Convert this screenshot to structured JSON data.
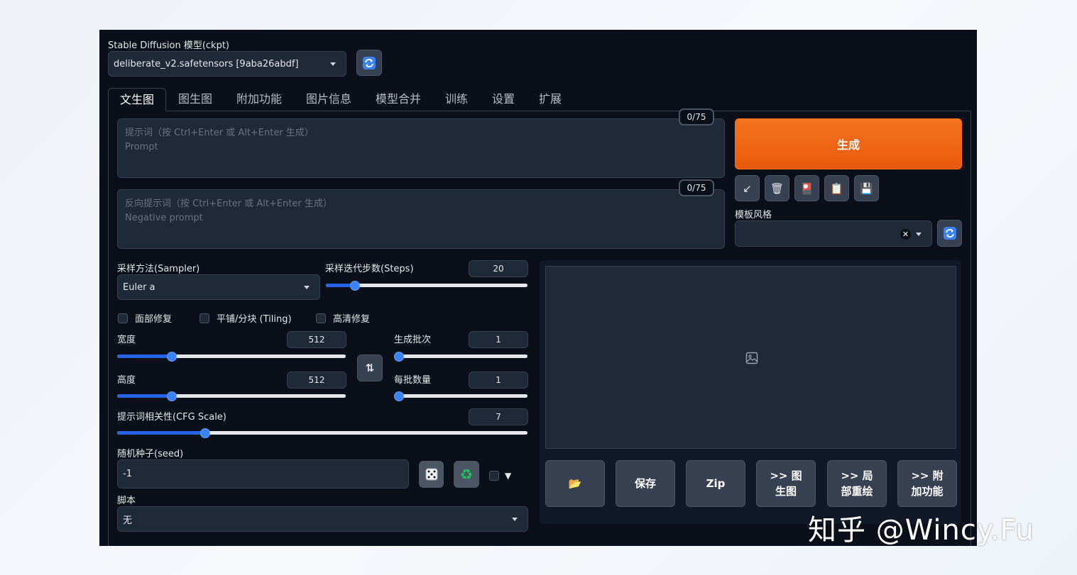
{
  "model": {
    "label": "Stable Diffusion 模型(ckpt)",
    "value": "deliberate_v2.safetensors [9aba26abdf]"
  },
  "tabs": [
    "文生图",
    "图生图",
    "附加功能",
    "图片信息",
    "模型合并",
    "训练",
    "设置",
    "扩展"
  ],
  "prompt": {
    "placeholder_line1": "提示词（按 Ctrl+Enter 或 Alt+Enter 生成）",
    "placeholder_line2": "Prompt",
    "counter": "0/75"
  },
  "negative_prompt": {
    "placeholder_line1": "反向提示词（按 Ctrl+Enter 或 Alt+Enter 生成）",
    "placeholder_line2": "Negative prompt",
    "counter": "0/75"
  },
  "generate_label": "生成",
  "tool_icons": [
    "↙",
    "🗑",
    "🎴",
    "📋",
    "💾"
  ],
  "style": {
    "label": "模板风格",
    "value": ""
  },
  "sampler": {
    "label": "采样方法(Sampler)",
    "value": "Euler a"
  },
  "steps": {
    "label": "采样迭代步数(Steps)",
    "value": "20",
    "min": 1,
    "max": 150,
    "current": 20
  },
  "checks": {
    "face": "面部修复",
    "tiling": "平铺/分块 (Tiling)",
    "hires": "高清修复"
  },
  "width": {
    "label": "宽度",
    "value": "512",
    "min": 64,
    "max": 2048,
    "current": 512
  },
  "height": {
    "label": "高度",
    "value": "512",
    "min": 64,
    "max": 2048,
    "current": 512
  },
  "batch_count": {
    "label": "生成批次",
    "value": "1",
    "min": 1,
    "max": 100,
    "current": 1
  },
  "batch_size": {
    "label": "每批数量",
    "value": "1",
    "min": 1,
    "max": 8,
    "current": 1
  },
  "cfg": {
    "label": "提示词相关性(CFG Scale)",
    "value": "7",
    "min": 1,
    "max": 30,
    "current": 7
  },
  "seed": {
    "label": "随机种子(seed)",
    "value": "-1",
    "extra_toggle": "▼"
  },
  "script": {
    "label": "脚本",
    "value": "无"
  },
  "actions": {
    "folder": "📂",
    "save": "保存",
    "zip": "Zip",
    "to_img2img": ">> 图\n生图",
    "to_inpaint": ">> 局\n部重绘",
    "to_extras": ">> 附\n加功能"
  },
  "watermark": "知乎 @Wincy.Fu"
}
